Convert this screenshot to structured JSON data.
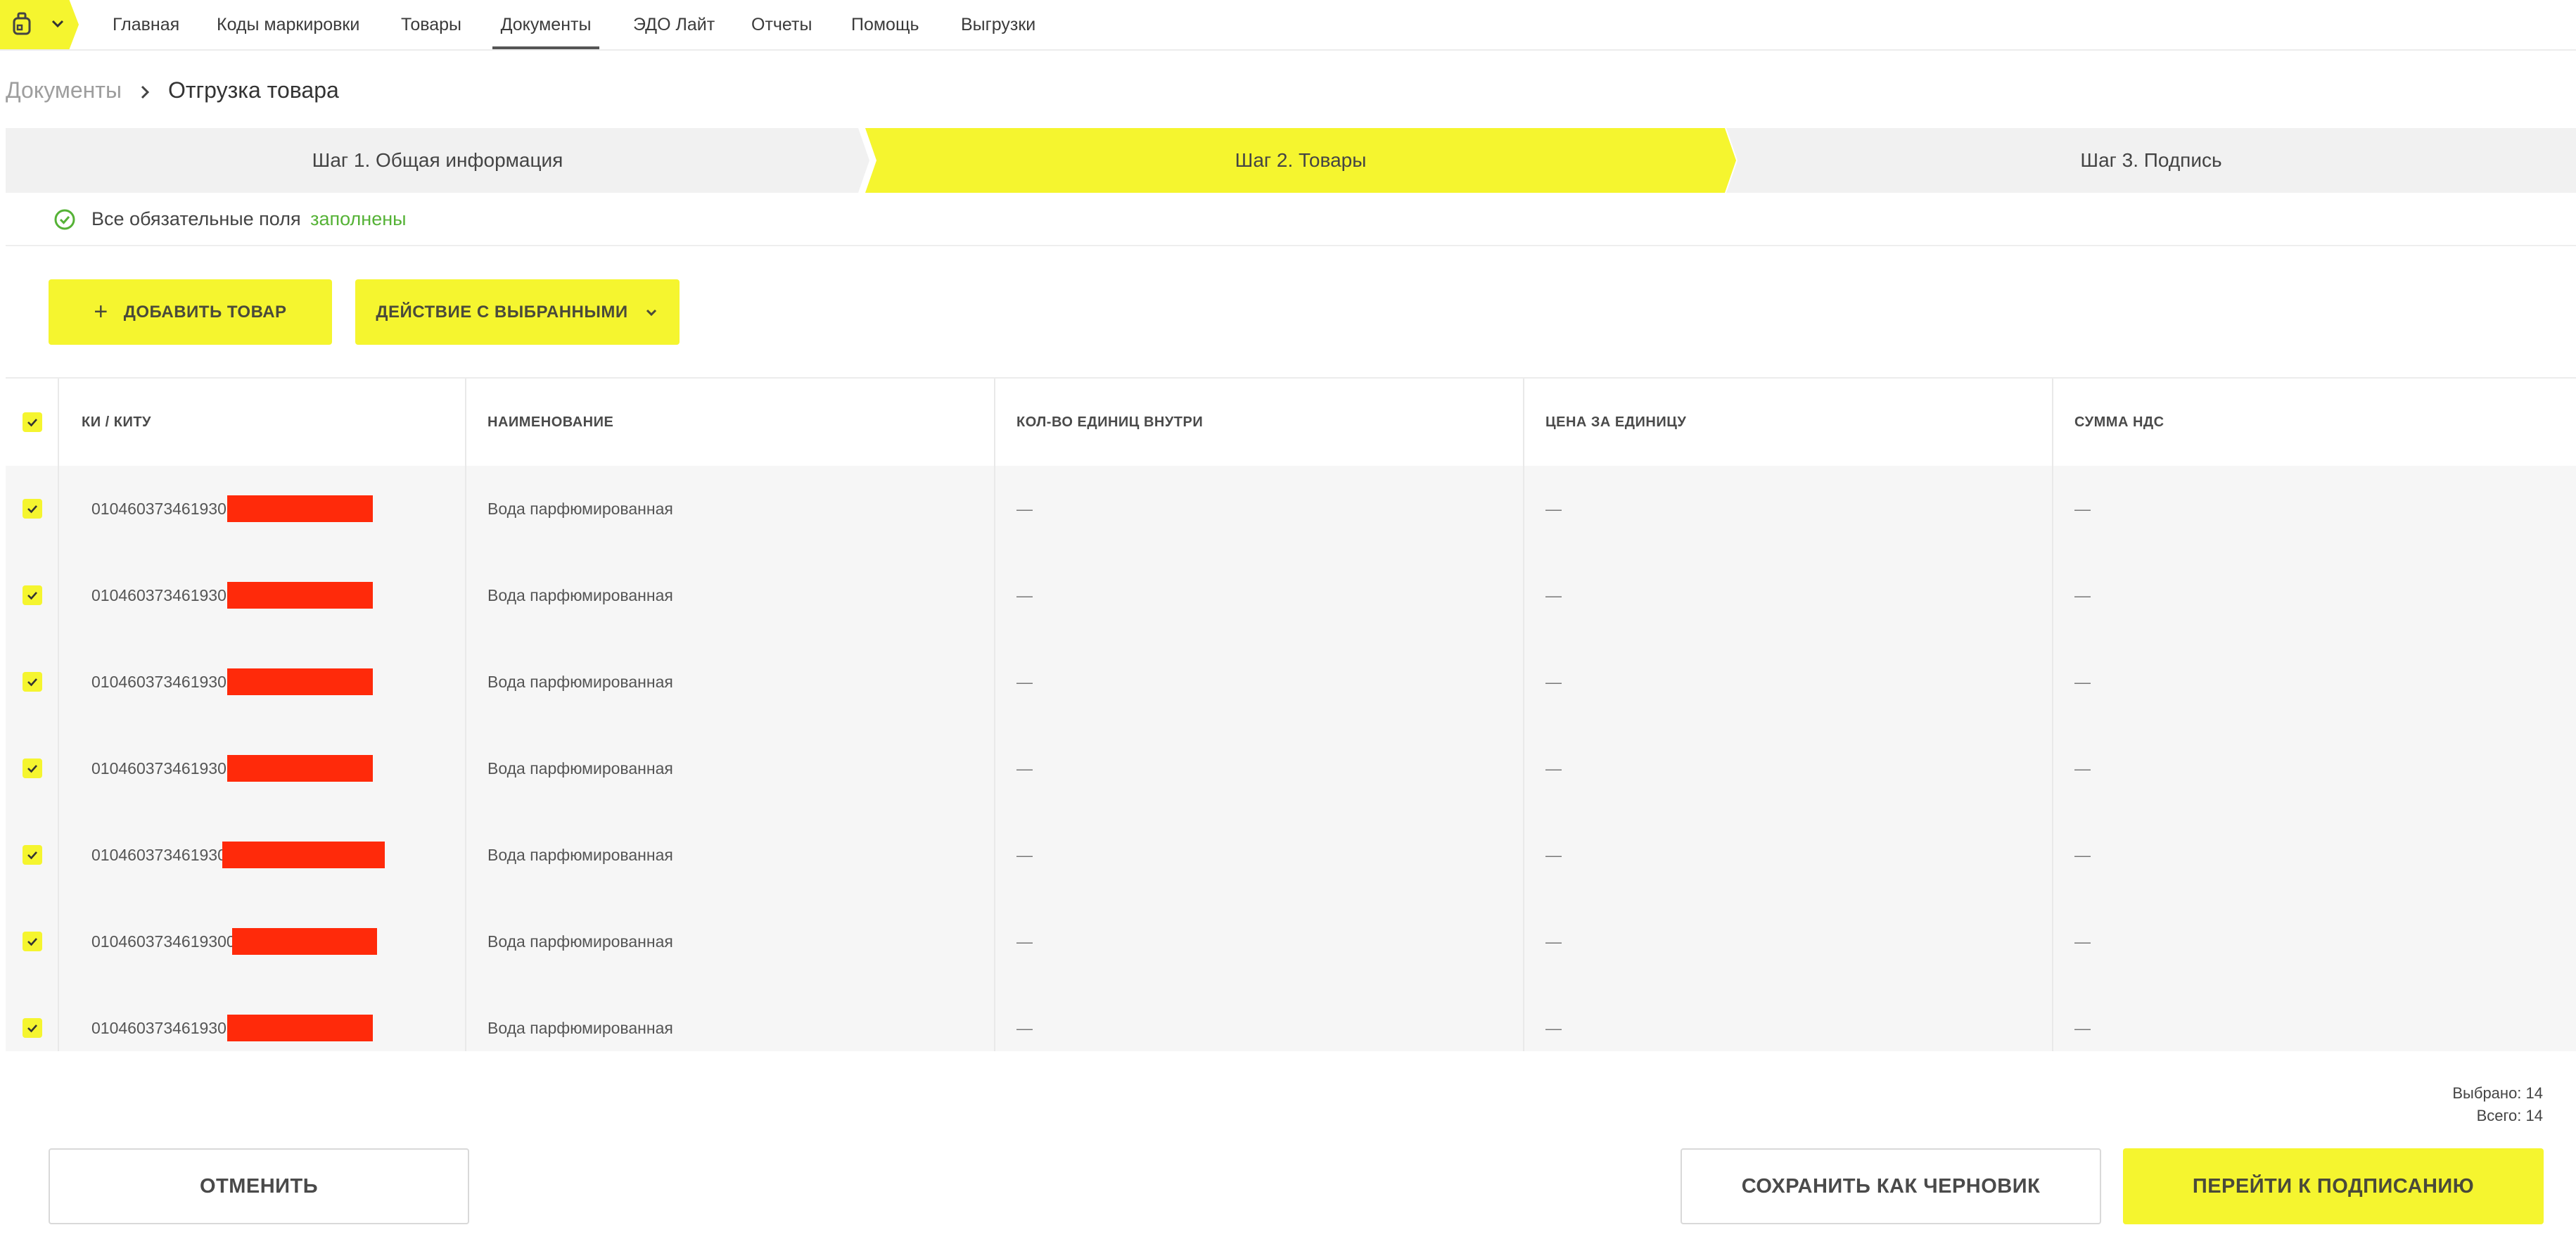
{
  "nav": {
    "items": [
      {
        "label": "Главная"
      },
      {
        "label": "Коды маркировки"
      },
      {
        "label": "Товары"
      },
      {
        "label": "Документы"
      },
      {
        "label": "ЭДО Лайт"
      },
      {
        "label": "Отчеты"
      },
      {
        "label": "Помощь"
      },
      {
        "label": "Выгрузки"
      }
    ],
    "active": "Документы"
  },
  "breadcrumb": {
    "root": "Документы",
    "current": "Отгрузка товара"
  },
  "steps": [
    {
      "label": "Шаг 1. Общая информация",
      "state": "done"
    },
    {
      "label": "Шаг 2. Товары",
      "state": "active"
    },
    {
      "label": "Шаг 3. Подпись",
      "state": "pending"
    }
  ],
  "status": {
    "text": "Все обязательные поля",
    "link": "заполнены"
  },
  "actions": {
    "add_label": "ДОБАВИТЬ ТОВАР",
    "add_icon": "+",
    "selected_label": "ДЕЙСТВИЕ С ВЫБРАННЫМИ"
  },
  "table": {
    "headers": {
      "code": "КИ / КИТУ",
      "name": "НАИМЕНОВАНИЕ",
      "qty": "КОЛ-ВО ЕДИНИЦ ВНУТРИ",
      "price": "ЦЕНА ЗА ЕДИНИЦУ",
      "vat": "СУММА НДС"
    },
    "rows": [
      {
        "code": "010460373461930",
        "name": "Вода парфюмированная",
        "qty": "—",
        "price": "—",
        "vat": "—",
        "checked": true
      },
      {
        "code": "010460373461930",
        "name": "Вода парфюмированная",
        "qty": "—",
        "price": "—",
        "vat": "—",
        "checked": true
      },
      {
        "code": "010460373461930",
        "name": "Вода парфюмированная",
        "qty": "—",
        "price": "—",
        "vat": "—",
        "checked": true
      },
      {
        "code": "010460373461930",
        "name": "Вода парфюмированная",
        "qty": "—",
        "price": "—",
        "vat": "—",
        "checked": true
      },
      {
        "code": "010460373461930",
        "name": "Вода парфюмированная",
        "qty": "—",
        "price": "—",
        "vat": "—",
        "checked": true
      },
      {
        "code": "0104603734619300",
        "name": "Вода парфюмированная",
        "qty": "—",
        "price": "—",
        "vat": "—",
        "checked": true
      },
      {
        "code": "010460373461930",
        "name": "Вода парфюмированная",
        "qty": "—",
        "price": "—",
        "vat": "—",
        "checked": true
      }
    ]
  },
  "summary": {
    "selected": "Выбрано: 14",
    "total": "Всего: 14"
  },
  "footer": {
    "cancel_label": "ОТМЕНИТЬ",
    "draft_label": "СОХРАНИТЬ КАК ЧЕРНОВИК",
    "sign_label": "ПЕРЕЙТИ К ПОДПИСАНИЮ"
  },
  "colors": {
    "accent": "#f5f52f",
    "success": "#55b236",
    "redaction": "#ff2a0a"
  }
}
